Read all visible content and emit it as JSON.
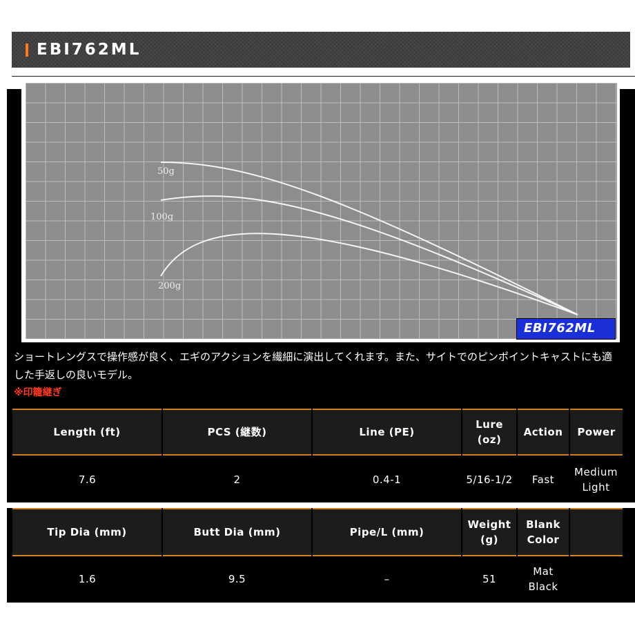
{
  "header": {
    "title": "EBI762ML"
  },
  "chart": {
    "badge": "EBI762ML",
    "curves": [
      {
        "label": "50g"
      },
      {
        "label": "100g"
      },
      {
        "label": "200g"
      }
    ],
    "colors": {
      "background": "#8d8d8d",
      "grid": "#bdbdbd",
      "curve": "#ffffff",
      "badge": "#1a2fd8"
    }
  },
  "description": {
    "text": "ショートレングスで操作感が良く、エギのアクションを繊細に演出してくれます。また、サイトでのピンポイントキャストにも適した手返しの良いモデル。",
    "note": "※印籠継ぎ"
  },
  "spec_table_1": {
    "headers": [
      "Length (ft)",
      "PCS (継数)",
      "Line (PE)",
      "Lure (oz)",
      "Action",
      "Power"
    ],
    "values": [
      "7.6",
      "2",
      "0.4-1",
      "5/16-1/2",
      "Fast",
      "Medium Light"
    ]
  },
  "spec_table_2": {
    "headers": [
      "Tip Dia (mm)",
      "Butt Dia (mm)",
      "Pipe/L (mm)",
      "Weight (g)",
      "Blank Color",
      ""
    ],
    "values": [
      "1.6",
      "9.5",
      "–",
      "51",
      "Mat Black",
      ""
    ]
  },
  "colors": {
    "accent": "#ff7a1a",
    "table_border": "#d4821e",
    "note": "#ff3a1f"
  }
}
